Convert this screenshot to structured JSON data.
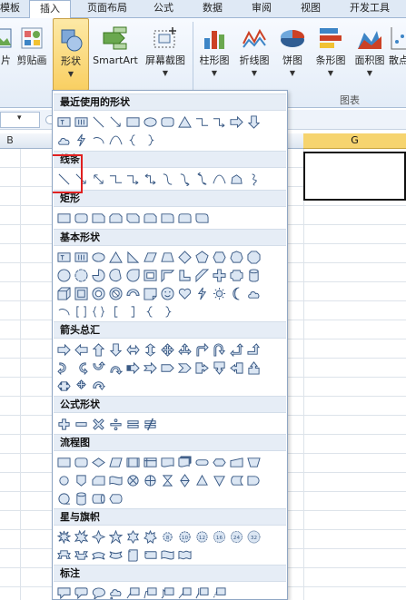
{
  "ribbon": {
    "tabs": [
      {
        "label": "模板",
        "active": false
      },
      {
        "label": "插入",
        "active": true
      },
      {
        "label": "页面布局",
        "active": false
      },
      {
        "label": "公式",
        "active": false
      },
      {
        "label": "数据",
        "active": false
      },
      {
        "label": "审阅",
        "active": false
      },
      {
        "label": "视图",
        "active": false
      },
      {
        "label": "开发工具",
        "active": false
      }
    ],
    "buttons": [
      {
        "label": "片",
        "icon": "picture-icon"
      },
      {
        "label": "剪贴画",
        "icon": "clipart-icon"
      },
      {
        "label": "形状",
        "icon": "shapes-icon"
      },
      {
        "label": "SmartArt",
        "icon": "smartart-icon"
      },
      {
        "label": "屏幕截图",
        "icon": "screenshot-icon"
      },
      {
        "label": "柱形图",
        "icon": "column-chart-icon"
      },
      {
        "label": "折线图",
        "icon": "line-chart-icon"
      },
      {
        "label": "饼图",
        "icon": "pie-chart-icon"
      },
      {
        "label": "条形图",
        "icon": "bar-chart-icon"
      },
      {
        "label": "面积图",
        "icon": "area-chart-icon"
      },
      {
        "label": "散点",
        "icon": "scatter-chart-icon"
      }
    ],
    "group_labels": {
      "chart": "图表"
    }
  },
  "sheet": {
    "column_headers": [
      "B",
      "G"
    ],
    "formula_bar": {
      "namebox_arrow": "▾"
    }
  },
  "shapes_menu": {
    "sections": [
      {
        "title": "最近使用的形状"
      },
      {
        "title": "线条"
      },
      {
        "title": "矩形"
      },
      {
        "title": "基本形状"
      },
      {
        "title": "箭头总汇"
      },
      {
        "title": "公式形状"
      },
      {
        "title": "流程图"
      },
      {
        "title": "星与旗帜"
      },
      {
        "title": "标注"
      }
    ]
  },
  "colors": {
    "accent": "#f9cf62",
    "panel_header": "#e6edf6",
    "highlight": "#e02020",
    "shape_fill": "#dbe6f3",
    "shape_stroke": "#3a5a85"
  }
}
